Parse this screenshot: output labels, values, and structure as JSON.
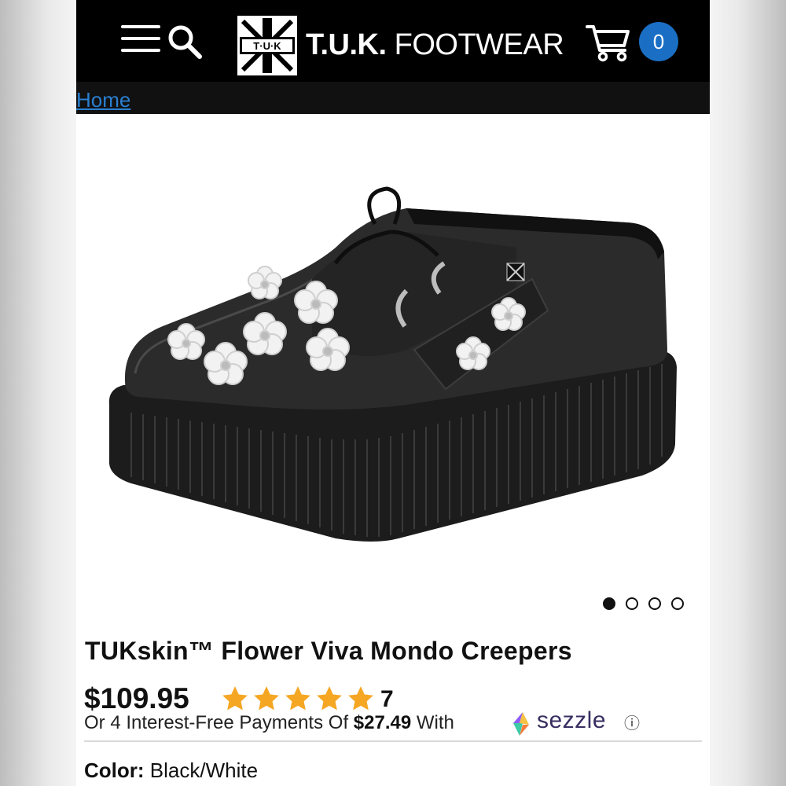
{
  "header": {
    "logo_mark": "T·U·K",
    "brand_bold": "T.U.K.",
    "brand_rest": "FOOTWEAR",
    "cart_count": "0",
    "icons": [
      "menu-icon",
      "search-icon",
      "cart-icon"
    ]
  },
  "breadcrumb": {
    "home": "Home"
  },
  "gallery": {
    "slides": 4,
    "active_slide": 1
  },
  "product": {
    "title": "TUKskin™ Flower Viva Mondo Creepers",
    "price": "$109.95",
    "rating": 5,
    "review_count": "7",
    "installment_prefix": "Or 4 Interest-Free Payments Of",
    "installment_amount": "$27.49",
    "installment_with": "With",
    "sezzle_brand": "sezzle",
    "info_glyph": "ⓘ",
    "color_label": "Color:",
    "color_value": "Black/White"
  },
  "colors": {
    "header_bg": "#000000",
    "link": "#2a7fd0",
    "cart_badge": "#1a6fc4",
    "star": "#f5a623",
    "sezzle_text": "#382e61"
  }
}
